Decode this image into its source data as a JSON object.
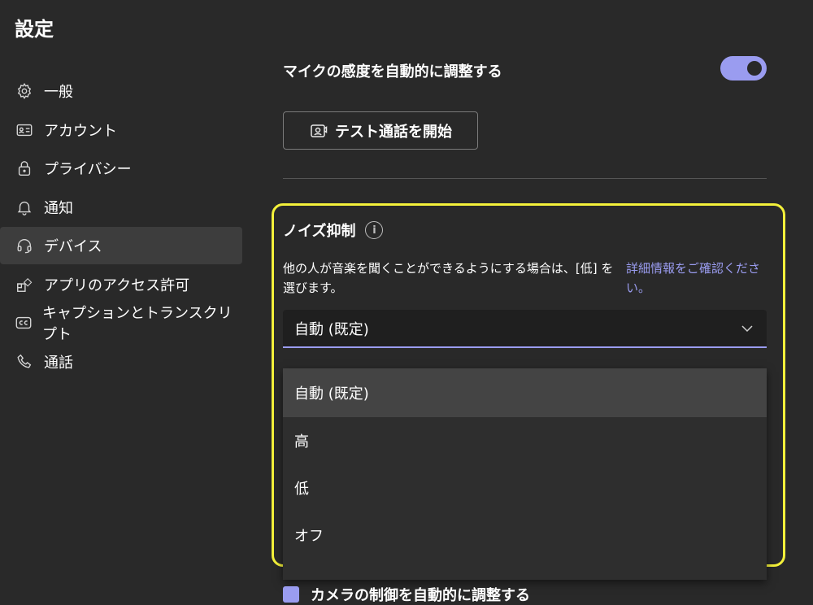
{
  "page_title": "設定",
  "sidebar": {
    "items": [
      {
        "label": "一般",
        "icon": "gear-icon"
      },
      {
        "label": "アカウント",
        "icon": "id-card-icon"
      },
      {
        "label": "プライバシー",
        "icon": "lock-icon"
      },
      {
        "label": "通知",
        "icon": "bell-icon"
      },
      {
        "label": "デバイス",
        "icon": "headset-icon",
        "active": true
      },
      {
        "label": "アプリのアクセス許可",
        "icon": "apps-icon"
      },
      {
        "label": "キャプションとトランスクリプト",
        "icon": "cc-icon"
      },
      {
        "label": "通話",
        "icon": "phone-icon"
      }
    ]
  },
  "mic": {
    "auto_adjust_label": "マイクの感度を自動的に調整する",
    "auto_adjust_on": true,
    "test_call_label": "テスト通話を開始"
  },
  "noise": {
    "title": "ノイズ抑制",
    "description": "他の人が音楽を聞くことができるようにする場合は、[低] を選びます。",
    "link": "詳細情報をご確認ください。",
    "selected": "自動 (既定)",
    "options": [
      "自動 (既定)",
      "高",
      "低",
      "オフ"
    ]
  },
  "camera": {
    "auto_adjust_label": "カメラの制御を自動的に調整する"
  },
  "colors": {
    "accent": "#9a9cf0",
    "highlight": "#f3f03a",
    "background": "#292929"
  }
}
